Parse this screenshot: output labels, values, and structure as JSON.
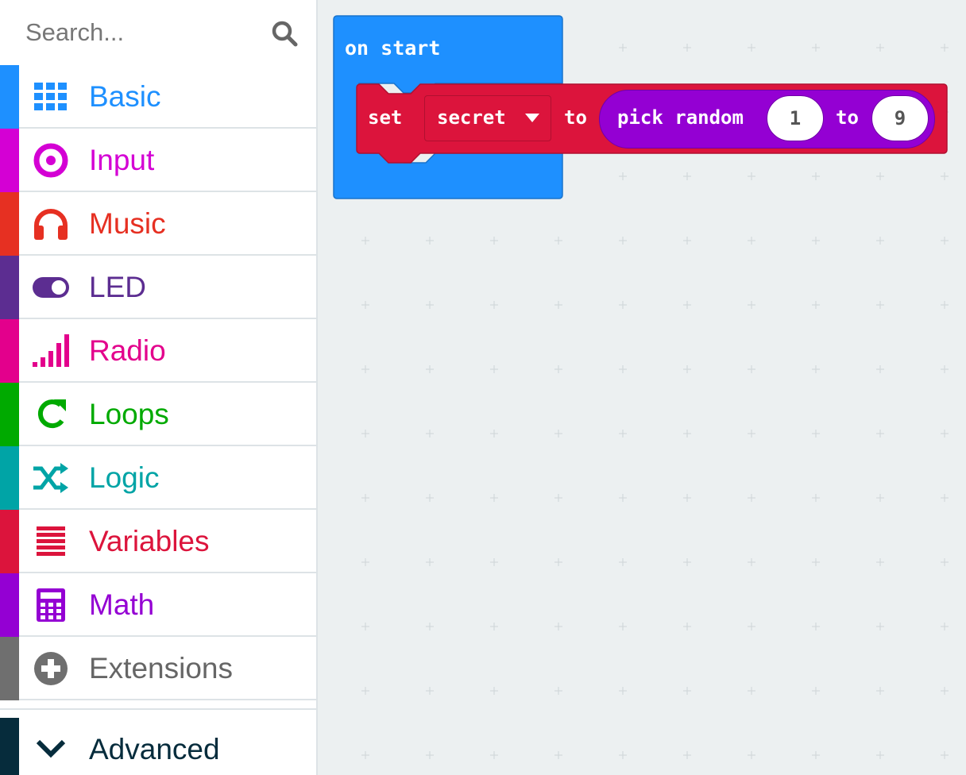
{
  "search": {
    "placeholder": "Search..."
  },
  "categories": [
    {
      "label": "Basic",
      "color": "#1e90ff",
      "icon": "grid-icon"
    },
    {
      "label": "Input",
      "color": "#d400d4",
      "icon": "radio-button-icon"
    },
    {
      "label": "Music",
      "color": "#e63022",
      "icon": "headphones-icon"
    },
    {
      "label": "LED",
      "color": "#5c2d91",
      "icon": "toggle-icon"
    },
    {
      "label": "Radio",
      "color": "#e3008c",
      "icon": "signal-bars-icon"
    },
    {
      "label": "Loops",
      "color": "#00aa00",
      "icon": "loop-arrow-icon"
    },
    {
      "label": "Logic",
      "color": "#00a4a6",
      "icon": "shuffle-icon"
    },
    {
      "label": "Variables",
      "color": "#dc143c",
      "icon": "list-lines-icon"
    },
    {
      "label": "Math",
      "color": "#9400d3",
      "icon": "calculator-icon"
    },
    {
      "label": "Extensions",
      "color": "#6f6f6f",
      "icon": "plus-circle-icon"
    }
  ],
  "advanced": {
    "label": "Advanced",
    "color": "#062c3c",
    "icon": "chevron-down-icon"
  },
  "workspace": {
    "on_start_block": {
      "label": "on start",
      "color": "#1e90ff"
    },
    "set_block": {
      "set_label": "set",
      "variable": "secret",
      "to_label": "to",
      "color": "#dc143c",
      "value_block": {
        "label": "pick random",
        "min": "1",
        "to_label": "to",
        "max": "9",
        "color": "#9400d3"
      }
    }
  }
}
